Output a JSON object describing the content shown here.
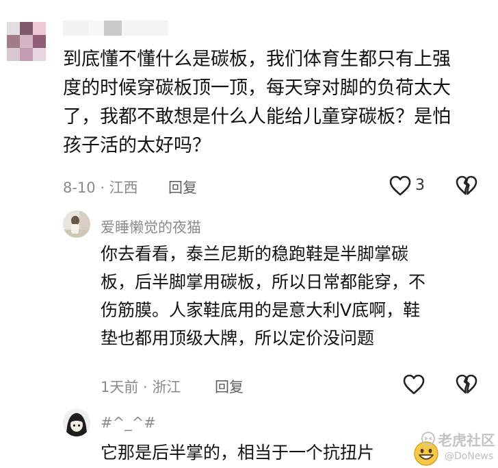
{
  "comment": {
    "text_lines": [
      "到底懂不懂什么是碳板，我们体育生都只有上强",
      "度的时候穿碳板顶一顶，每天穿对脚的负荷太大",
      "了，我都不敢想是什么人能给儿童穿碳板？是怕",
      "孩子活的太好吗？"
    ],
    "meta": "8-10 · 江西",
    "reply_label": "回复",
    "like_count": "3"
  },
  "replies": [
    {
      "username": "爱睡懒觉的夜猫",
      "text_lines": [
        "你去看看，泰兰尼斯的稳跑鞋是半脚掌碳",
        "板，后半脚掌用碳板，所以日常都能穿，不",
        "伤筋膜。人家鞋底用的是意大利V底啊，鞋",
        "垫也都用顶级大牌，所以定价没问题"
      ],
      "meta": "1天前 · 浙江",
      "reply_label": "回复"
    },
    {
      "username": "#^_^#",
      "text_lines": [
        "它那是后半掌的，相当于一个抗扭片"
      ]
    }
  ],
  "watermark": {
    "brand": "老虎社区",
    "handle": "@DoNews"
  },
  "colors": {
    "text": "#111111",
    "meta": "#8a8a8a",
    "reply": "#5f5f5f"
  },
  "icons": [
    "heart-outline-icon",
    "broken-heart-icon",
    "grinning-emoji",
    "tiger-logo-icon"
  ]
}
